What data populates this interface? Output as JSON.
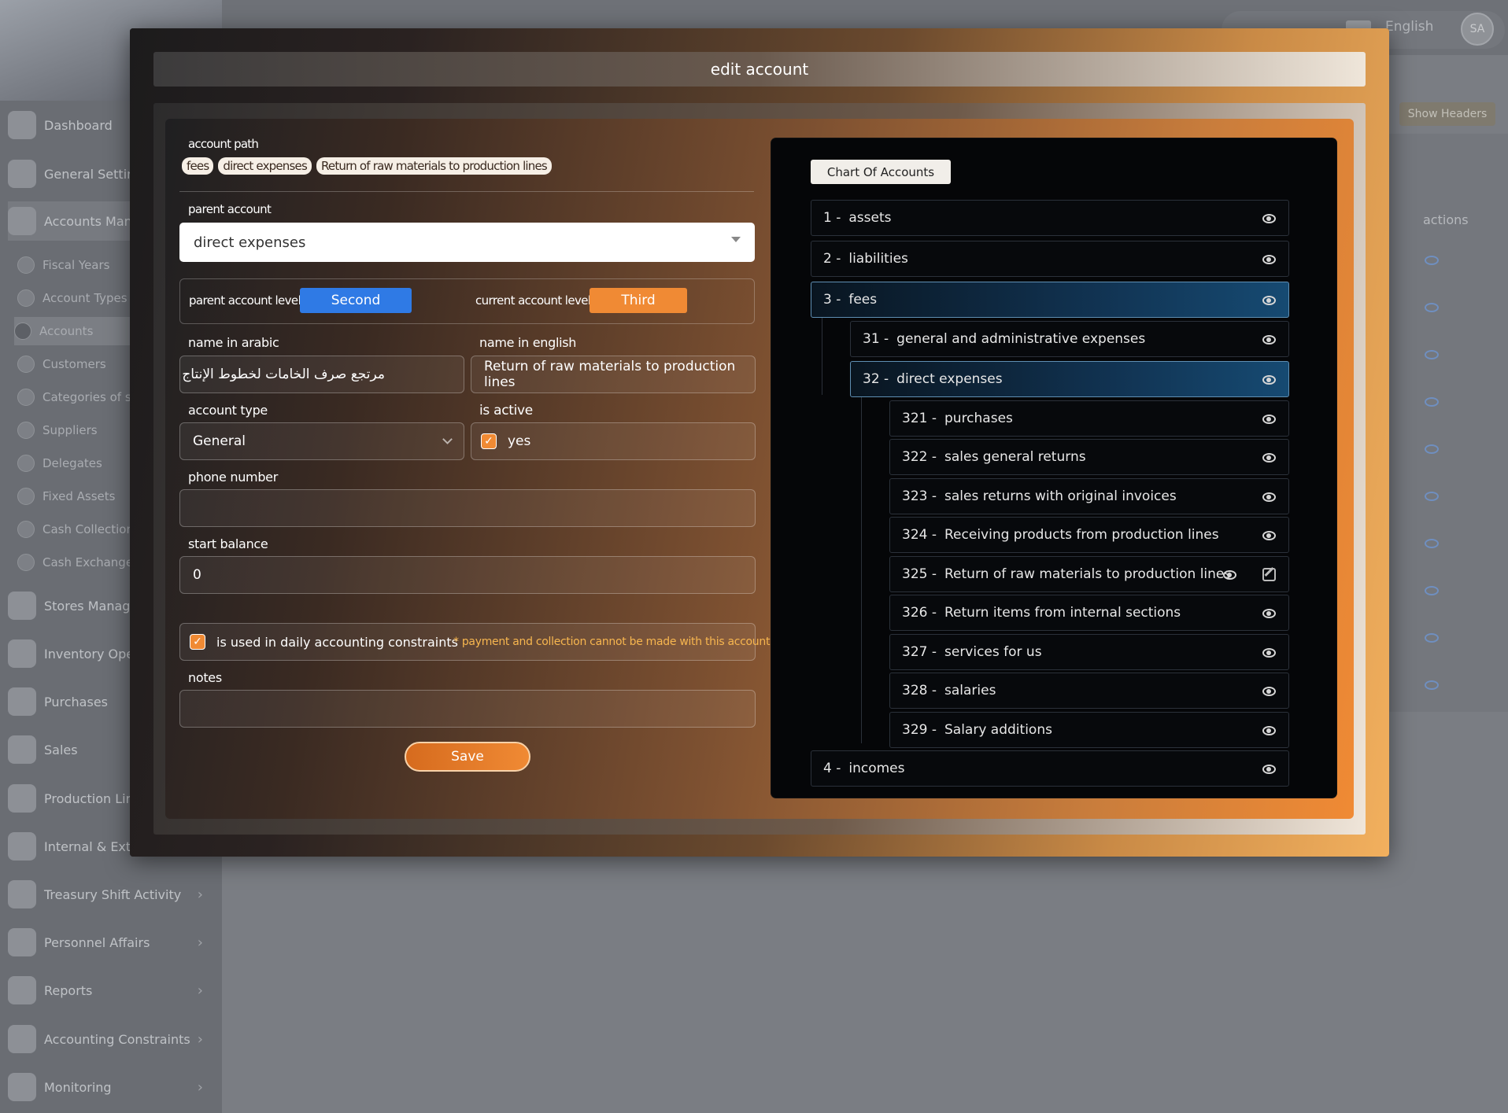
{
  "app": {
    "language": "English",
    "avatar_initials": "SA",
    "show_headers_label": "Show Headers",
    "actions_label": "actions"
  },
  "sidebar": {
    "items": [
      {
        "label": "Dashboard"
      },
      {
        "label": "General Settings"
      },
      {
        "label": "Accounts Management"
      }
    ],
    "sub_items": [
      {
        "label": "Fiscal Years"
      },
      {
        "label": "Account Types"
      },
      {
        "label": "Accounts"
      },
      {
        "label": "Customers"
      },
      {
        "label": "Categories of suppliers"
      },
      {
        "label": "Suppliers"
      },
      {
        "label": "Delegates"
      },
      {
        "label": "Fixed Assets"
      },
      {
        "label": "Cash Collection"
      },
      {
        "label": "Cash Exchange"
      }
    ],
    "more_items": [
      {
        "label": "Stores Management"
      },
      {
        "label": "Inventory Operations"
      },
      {
        "label": "Purchases"
      },
      {
        "label": "Sales"
      },
      {
        "label": "Production Lines"
      },
      {
        "label": "Internal & External"
      },
      {
        "label": "Treasury Shift Activity"
      },
      {
        "label": "Personnel Affairs"
      },
      {
        "label": "Reports"
      },
      {
        "label": "Accounting Constraints"
      },
      {
        "label": "Monitoring"
      }
    ]
  },
  "modal": {
    "title": "edit account",
    "account_path_label": "account path",
    "account_path": [
      "fees",
      "direct expenses",
      "Return of raw materials to production lines"
    ],
    "parent_account_label": "parent account",
    "parent_account_value": "direct expenses",
    "parent_level_label": "parent account level :",
    "parent_level_value": "Second",
    "current_level_label": "current account level :",
    "current_level_value": "Third",
    "name_arabic_label": "name in arabic",
    "name_arabic_value": "مرتجع صرف الخامات لخطوط الإنتاج",
    "name_english_label": "name in english",
    "name_english_value": "Return of raw materials to production lines",
    "account_type_label": "account type",
    "account_type_value": "General",
    "is_active_label": "is active",
    "is_active_value": "yes",
    "phone_label": "phone number",
    "phone_value": "",
    "start_balance_label": "start balance",
    "start_balance_value": "0",
    "daily_constraints_label": "is used in daily accounting constraints",
    "daily_constraints_warning": "* payment and collection cannot be made with this account",
    "notes_label": "notes",
    "notes_value": "",
    "save_label": "Save"
  },
  "chart_of_accounts": {
    "title": "Chart Of Accounts",
    "rows": [
      {
        "num": "1 -",
        "name": "assets"
      },
      {
        "num": "2 -",
        "name": "liabilities"
      },
      {
        "num": "3 -",
        "name": "fees"
      },
      {
        "num": "31 -",
        "name": "general and administrative expenses"
      },
      {
        "num": "32 -",
        "name": "direct expenses"
      },
      {
        "num": "321 -",
        "name": "purchases"
      },
      {
        "num": "322 -",
        "name": "sales general returns"
      },
      {
        "num": "323 -",
        "name": "sales returns with original invoices"
      },
      {
        "num": "324 -",
        "name": "Receiving products from production lines"
      },
      {
        "num": "325 -",
        "name": "Return of raw materials to production lines"
      },
      {
        "num": "326 -",
        "name": "Return items from internal sections"
      },
      {
        "num": "327 -",
        "name": "services for us"
      },
      {
        "num": "328 -",
        "name": "salaries"
      },
      {
        "num": "329 -",
        "name": "Salary additions"
      },
      {
        "num": "4 -",
        "name": "incomes"
      }
    ]
  },
  "colors": {
    "accent_orange": "#f08a34",
    "accent_blue": "#2f7ae5",
    "selected_row": "#164a72"
  }
}
